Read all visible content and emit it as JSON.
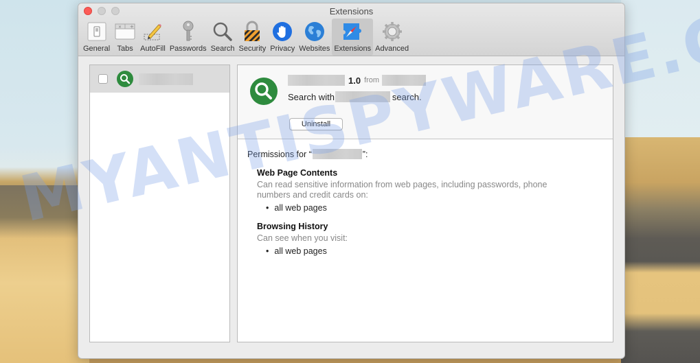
{
  "window": {
    "title": "Extensions"
  },
  "toolbar": {
    "items": [
      {
        "label": "General",
        "icon": "general-switch-icon",
        "active": false
      },
      {
        "label": "Tabs",
        "icon": "tabs-icon",
        "active": false
      },
      {
        "label": "AutoFill",
        "icon": "pencil-icon",
        "active": false
      },
      {
        "label": "Passwords",
        "icon": "key-icon",
        "active": false
      },
      {
        "label": "Search",
        "icon": "magnifier-icon",
        "active": false
      },
      {
        "label": "Security",
        "icon": "padlock-icon",
        "active": false
      },
      {
        "label": "Privacy",
        "icon": "hand-icon",
        "active": false
      },
      {
        "label": "Websites",
        "icon": "globe-icon",
        "active": false
      },
      {
        "label": "Extensions",
        "icon": "puzzle-compass-icon",
        "active": true
      },
      {
        "label": "Advanced",
        "icon": "gear-icon",
        "active": false
      }
    ]
  },
  "extension_list": {
    "items": [
      {
        "name": "[redacted]",
        "enabled": false,
        "icon": "green-search-icon"
      }
    ]
  },
  "detail": {
    "name": "[redacted]",
    "version": "1.0",
    "from_label": "from",
    "developer": "[redacted]",
    "description_prefix": "Search with",
    "description_suffix": "search.",
    "uninstall_label": "Uninstall",
    "permissions_prefix": "Permissions for “",
    "permissions_suffix": "”:",
    "permissions": [
      {
        "title": "Web Page Contents",
        "description": "Can read sensitive information from web pages, including passwords, phone numbers and credit cards on:",
        "scopes": [
          "all web pages"
        ]
      },
      {
        "title": "Browsing History",
        "description": "Can see when you visit:",
        "scopes": [
          "all web pages"
        ]
      }
    ]
  },
  "watermark": {
    "text": "MYANTISPYWARE.COM"
  },
  "colors": {
    "accent_green": "#2e8b3e",
    "close_red": "#fc5b57",
    "muted_text": "#888888"
  }
}
